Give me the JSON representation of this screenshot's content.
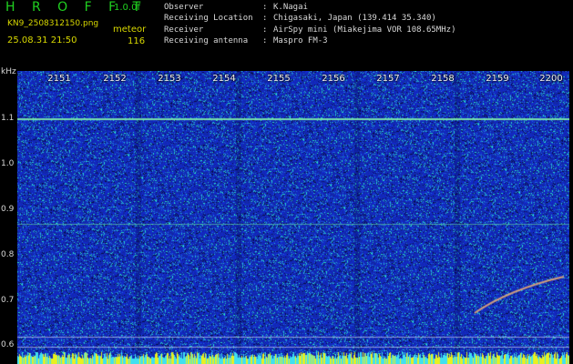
{
  "header": {
    "title": "H R O F F T",
    "version": "1.0.0f",
    "filename": "KN9_2508312150.png",
    "datetime": "25.08.31 21:50",
    "meteor_label": "meteor",
    "meteor_count": "116"
  },
  "info": [
    {
      "key": "Observer",
      "value": "K.Nagai"
    },
    {
      "key": "Receiving Location",
      "value": "Chigasaki, Japan (139.414 35.340)"
    },
    {
      "key": "Receiver",
      "value": "AirSpy mini (Miakejima VOR 108.65MHz)"
    },
    {
      "key": "Receiving antenna",
      "value": "Maspro FM-3"
    }
  ],
  "axis": {
    "y_unit": "kHz",
    "y_ticks": [
      "1.1",
      "1.0",
      "0.9",
      "0.8",
      "0.7",
      "0.6"
    ],
    "x_ticks": [
      "2151",
      "2152",
      "2153",
      "2154",
      "2155",
      "2156",
      "2157",
      "2158",
      "2159",
      "2200"
    ]
  },
  "colors": {
    "background": "#000000",
    "spectrum_base": "#1530b8",
    "header_green": "#20d020",
    "header_yellow": "#d8d800",
    "text_white": "#d8d8d8"
  }
}
